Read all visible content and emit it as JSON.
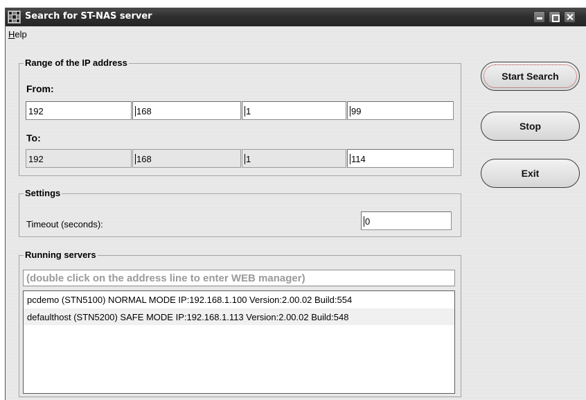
{
  "window": {
    "title": "Search for ST-NAS server",
    "controls": [
      "minimize-icon",
      "maximize-icon",
      "close-icon"
    ]
  },
  "menu": {
    "help_accel": "H",
    "help_rest": "elp"
  },
  "ip_range": {
    "title": "Range of the IP address",
    "from_label": "From:",
    "to_label": "To:",
    "from": [
      "192",
      "168",
      "1",
      "99"
    ],
    "to": [
      "192",
      "168",
      "1",
      "114"
    ]
  },
  "settings": {
    "title": "Settings",
    "timeout_label": "Timeout (seconds):",
    "timeout_value": "0"
  },
  "servers": {
    "title": "Running servers",
    "hint": "(double click on the address line to enter WEB manager)",
    "rows": [
      "pcdemo (STN5100) NORMAL MODE IP:192.168.1.100 Version:2.00.02 Build:554",
      "defaulthost (STN5200) SAFE MODE IP:192.168.1.113 Version:2.00.02 Build:548"
    ]
  },
  "buttons": {
    "start": "Start Search",
    "stop": "Stop",
    "exit": "Exit"
  },
  "colors": {
    "titlebar": "#2e2e2e",
    "focus_ring": "#aa3333",
    "hint_text": "#9a9a9a"
  }
}
